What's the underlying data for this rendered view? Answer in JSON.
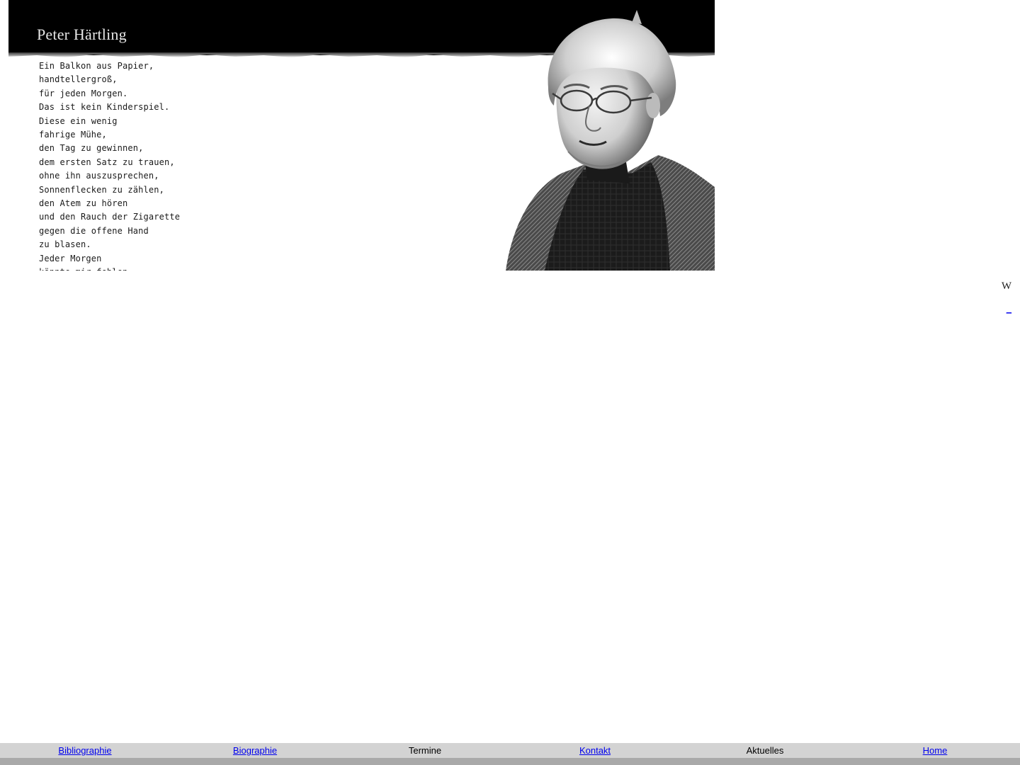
{
  "header": {
    "title": "Peter Härtling"
  },
  "poem": {
    "lines": [
      "Ein Balkon aus Papier,",
      "handtellergroß,",
      "für jeden Morgen.",
      "Das ist kein Kinderspiel.",
      "Diese ein wenig",
      "fahrige Mühe,",
      "den Tag zu gewinnen,",
      "dem ersten Satz zu trauen,",
      "ohne ihn auszusprechen,",
      "Sonnenflecken zu zählen,",
      "den Atem zu hören",
      "und den Rauch der Zigarette",
      "gegen die offene Hand",
      "zu blasen.",
      "Jeder Morgen",
      "könnte mir fehlen."
    ]
  },
  "side": {
    "glyph": "W",
    "link": "_"
  },
  "nav": {
    "items": [
      {
        "label": "Bibliographie",
        "link": true
      },
      {
        "label": "Biographie",
        "link": true
      },
      {
        "label": "Termine",
        "link": false
      },
      {
        "label": "Kontakt",
        "link": true
      },
      {
        "label": "Aktuelles",
        "link": false
      },
      {
        "label": "Home",
        "link": true
      }
    ]
  },
  "colors": {
    "band": "#000000",
    "nav_bar": "#d3d3d3",
    "bottom_strip": "#a9a9a9",
    "link": "#0000ee"
  },
  "images": {
    "portrait": "portrait-photo"
  }
}
